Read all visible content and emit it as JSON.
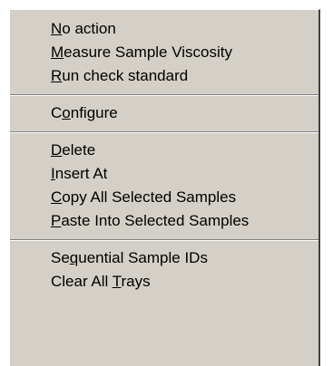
{
  "context_menu": {
    "groups": [
      {
        "items": [
          {
            "pre": "",
            "key": "N",
            "post": "o action"
          },
          {
            "pre": "",
            "key": "M",
            "post": "easure Sample Viscosity"
          },
          {
            "pre": "",
            "key": "R",
            "post": "un check standard"
          }
        ]
      },
      {
        "items": [
          {
            "pre": "C",
            "key": "o",
            "post": "nfigure"
          }
        ]
      },
      {
        "items": [
          {
            "pre": "",
            "key": "D",
            "post": "elete"
          },
          {
            "pre": "",
            "key": "I",
            "post": "nsert At"
          },
          {
            "pre": "",
            "key": "C",
            "post": "opy All Selected Samples"
          },
          {
            "pre": "",
            "key": "P",
            "post": "aste Into Selected Samples"
          }
        ]
      },
      {
        "items": [
          {
            "pre": "Se",
            "key": "q",
            "post": "uential Sample IDs"
          },
          {
            "pre": "Clear All ",
            "key": "T",
            "post": "rays"
          }
        ]
      }
    ]
  }
}
